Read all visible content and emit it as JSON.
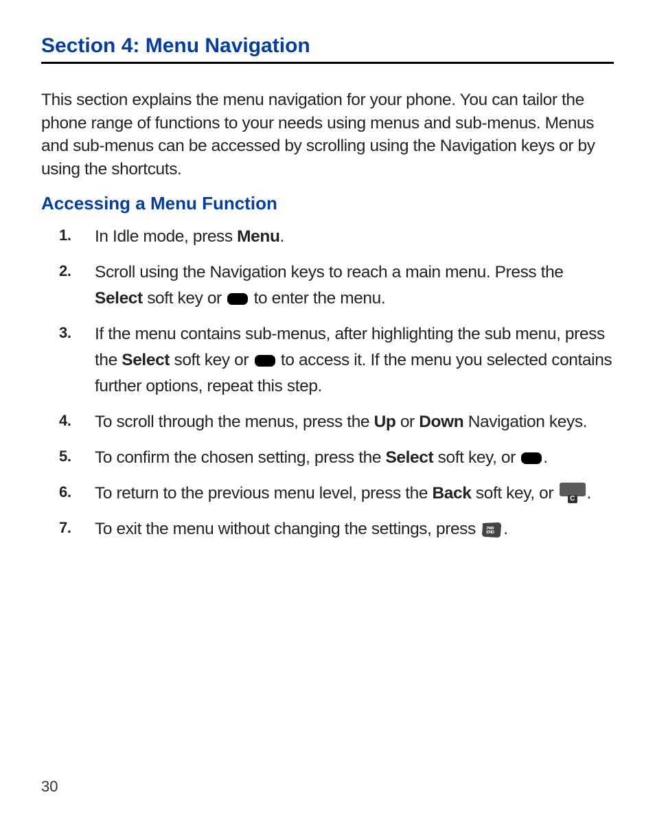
{
  "section": {
    "title": "Section 4: Menu Navigation"
  },
  "intro": "This section explains the menu navigation for your phone. You can tailor the phone range of functions to your needs using menus and sub-menus. Menus and sub-menus can be accessed by scrolling using the Navigation keys or by using the shortcuts.",
  "subhead": "Accessing a Menu Function",
  "steps": {
    "s1a": "In Idle mode, press ",
    "s1b": "Menu",
    "s1c": ".",
    "s2a": "Scroll using the Navigation keys to reach a main menu. Press the ",
    "s2b": "Select",
    "s2c": " soft key or ",
    "s2d": " to enter the menu.",
    "s3a": "If the menu contains sub-menus, after highlighting the sub menu, press the ",
    "s3b": "Select",
    "s3c": " soft key or ",
    "s3d": " to access it. If the menu you selected contains further options, repeat this step.",
    "s4a": "To scroll through the menus, press the ",
    "s4b": "Up",
    "s4c": " or ",
    "s4d": "Down",
    "s4e": " Navigation keys.",
    "s5a": "To confirm the chosen setting, press the ",
    "s5b": "Select",
    "s5c": " soft key, or ",
    "s5d": ".",
    "s6a": "To return to the previous menu level, press the ",
    "s6b": "Back",
    "s6c": " soft key, or ",
    "s6d": ".",
    "s7a": "To exit the menu without changing the settings, press ",
    "s7b": "."
  },
  "icons": {
    "nav_key": "nav-key",
    "c_key": "c-key",
    "end_key": "pwr-end-key",
    "c_letter": "C"
  },
  "page_number": "30"
}
